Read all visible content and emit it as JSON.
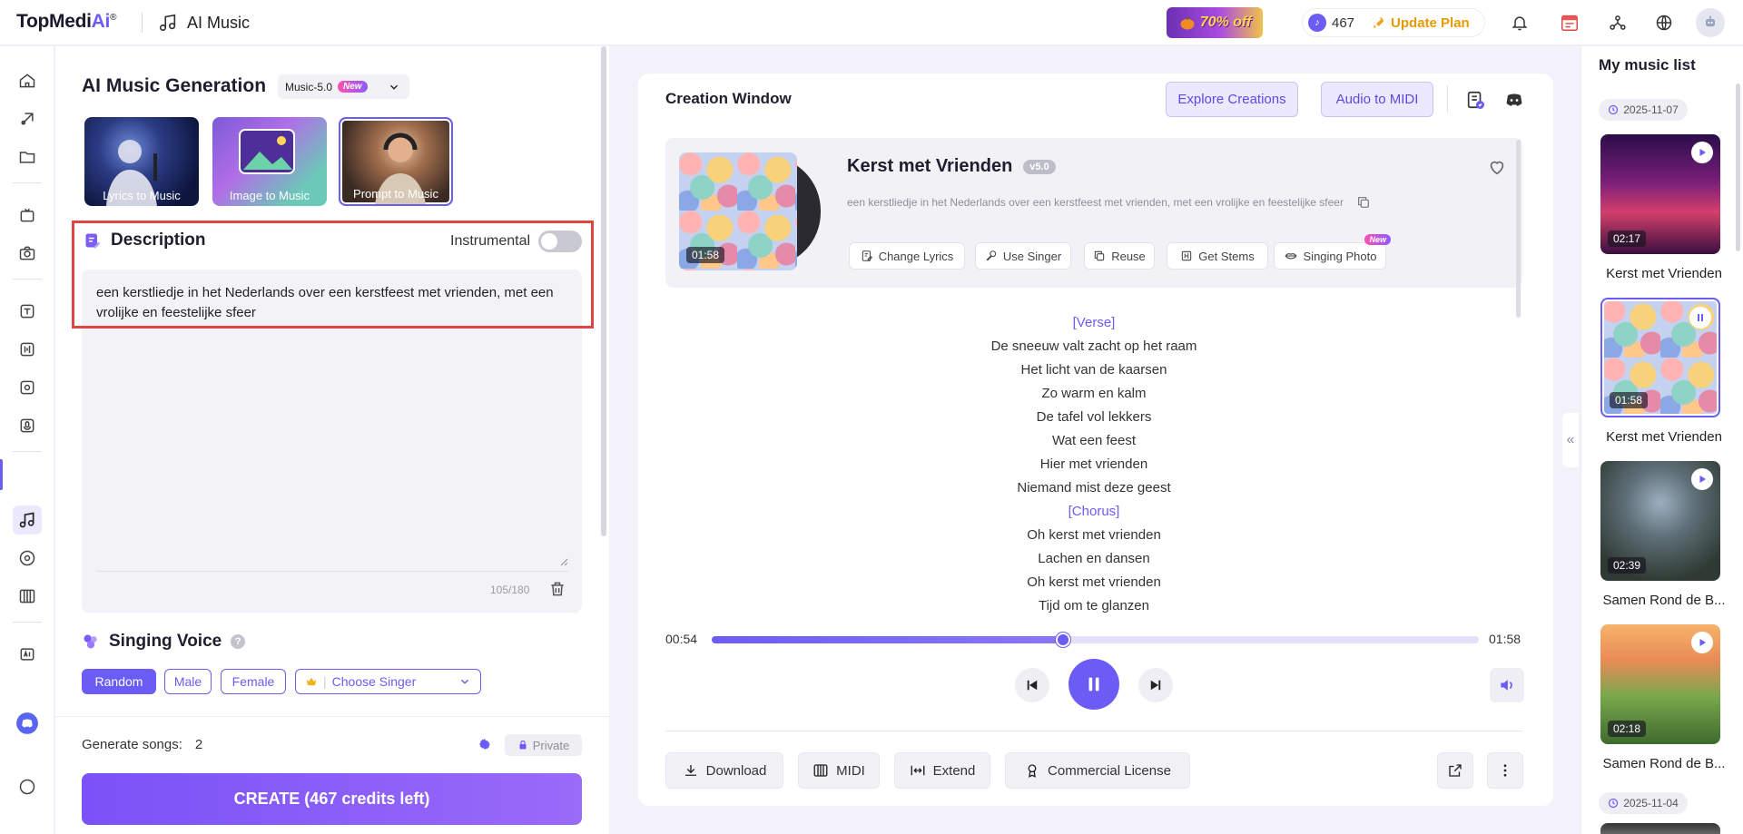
{
  "header": {
    "logo_text": "TopMedi",
    "logo_ai": "Ai",
    "logo_reg": "®",
    "app_title": "AI Music",
    "promo": "70% off",
    "credits": "467",
    "update_plan": "Update Plan"
  },
  "generation": {
    "title": "AI Music Generation",
    "model": "Music-5.0",
    "model_badge": "New",
    "modes": [
      "Lyrics to Music",
      "Image to Music",
      "Prompt to Music"
    ],
    "selected_mode": "Prompt to Music"
  },
  "description": {
    "title": "Description",
    "instrumental_label": "Instrumental",
    "instrumental_on": false,
    "text": "een kerstliedje in het Nederlands over een kerstfeest met vrienden, met een vrolijke en feestelijke sfeer",
    "count": "105/180"
  },
  "voice": {
    "title": "Singing Voice",
    "options": [
      "Random",
      "Male",
      "Female"
    ],
    "selected": "Random",
    "choose_singer": "Choose Singer"
  },
  "bottom": {
    "generate_label": "Generate songs:",
    "generate_count": "2",
    "private_label": "Private",
    "create_label": "CREATE (467 credits left)"
  },
  "creation": {
    "title": "Creation Window",
    "explore": "Explore Creations",
    "audio_midi": "Audio to MIDI"
  },
  "song": {
    "title": "Kerst met Vrienden",
    "version": "v5.0",
    "description": "een kerstliedje in het Nederlands over een kerstfeest met vrienden, met een vrolijke en feestelijke sfeer",
    "duration": "01:58",
    "actions": [
      "Change Lyrics",
      "Use Singer",
      "Reuse",
      "Get Stems",
      "Singing Photo"
    ],
    "singing_photo_badge": "New",
    "lyrics": [
      "[Verse]",
      "De sneeuw valt zacht op het raam",
      "Het licht van de kaarsen",
      "Zo warm en kalm",
      "De tafel vol lekkers",
      "Wat een feest",
      "Hier met vrienden",
      "Niemand mist deze geest",
      "[Chorus]",
      "Oh kerst met vrienden",
      "Lachen en dansen",
      "Oh kerst met vrienden",
      "Tijd om te glanzen"
    ]
  },
  "player": {
    "current": "00:54",
    "total": "01:58",
    "progress_fraction": 0.4576
  },
  "bottom_actions": {
    "download": "Download",
    "midi": "MIDI",
    "extend": "Extend",
    "license": "Commercial License"
  },
  "music_list": {
    "title": "My music list",
    "date1": "2025-11-07",
    "date2": "2025-11-04",
    "items": [
      {
        "title": "Kerst met Vrienden",
        "time": "02:17"
      },
      {
        "title": "Kerst met Vrienden",
        "time": "01:58"
      },
      {
        "title": "Samen Rond de B...",
        "time": "02:39"
      },
      {
        "title": "Samen Rond de B...",
        "time": "02:18"
      }
    ]
  },
  "colors": {
    "accent": "#6b5cf5",
    "highlight_border": "#e04545",
    "upgrade": "#e69a00"
  }
}
